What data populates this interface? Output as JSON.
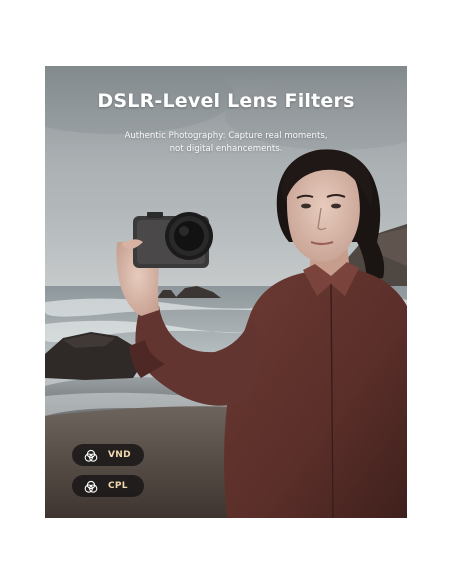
{
  "banner": {
    "title": "DSLR-Level Lens Filters",
    "subtitle_line1": "Authentic Photography: Capture real moments,",
    "subtitle_line2": "not digital enhancements."
  },
  "filters": [
    {
      "label": "VND",
      "icon": "filter-rings-icon"
    },
    {
      "label": "CPL",
      "icon": "filter-rings-icon"
    }
  ],
  "colors": {
    "chip_background": "#1a1818",
    "chip_text": "#f2d9b0",
    "title_text": "#ffffff"
  }
}
